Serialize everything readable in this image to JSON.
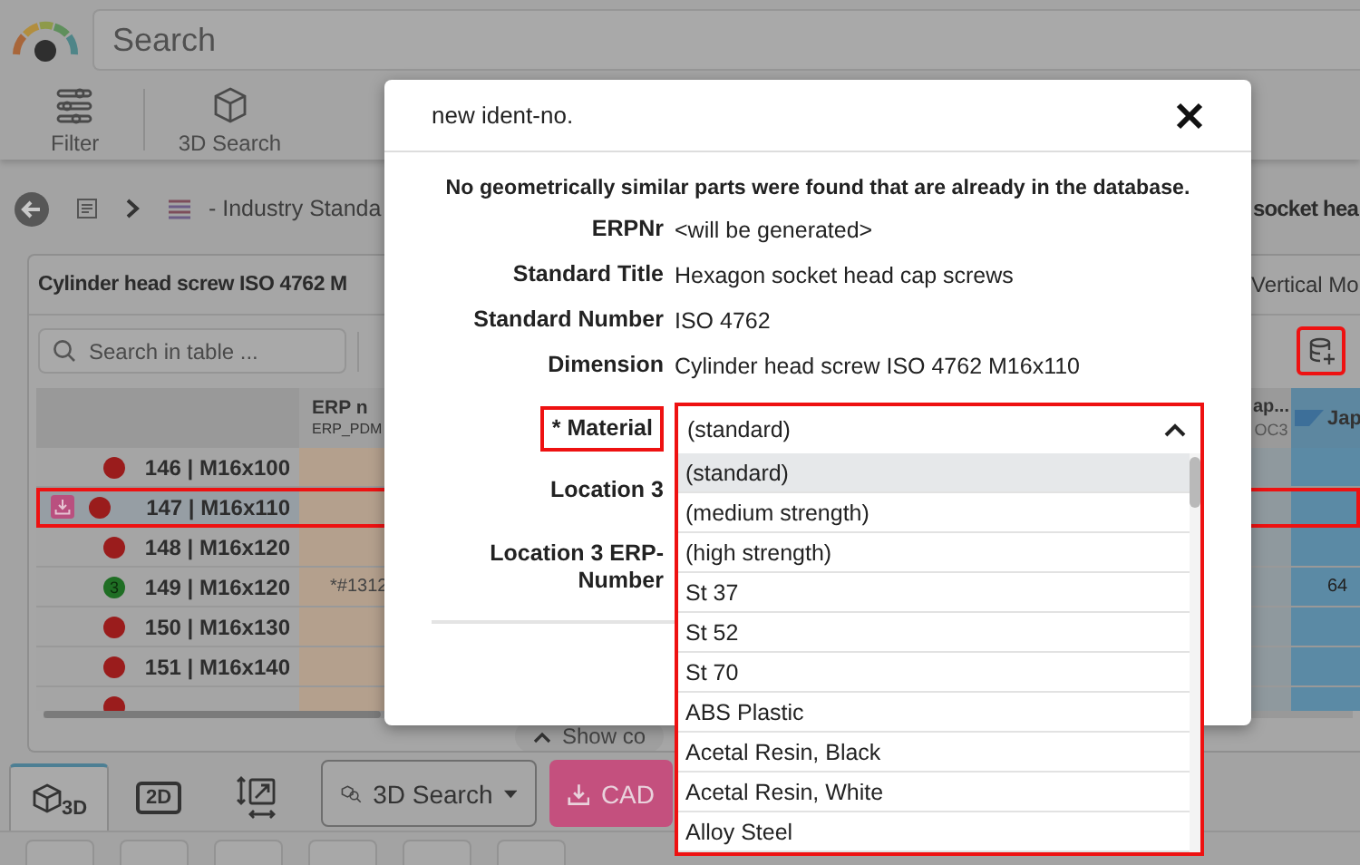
{
  "search": {
    "placeholder": "Search"
  },
  "toolbar": [
    {
      "label": "Filter"
    },
    {
      "label": "3D Search"
    }
  ],
  "breadcrumb": {
    "path_text": "- Industry Standa",
    "title_text": "socket hea"
  },
  "panel": {
    "title": "Cylinder head screw ISO 4762 M",
    "side_tab": "Vertical Mo",
    "table_search": {
      "placeholder": "Search in table ..."
    },
    "add_button_highlighted": true
  },
  "table": {
    "columns": [
      {
        "title": "ERP n",
        "subtitle": "ERP_PDM"
      },
      {
        "title": "ap...",
        "subtitle": "OC3"
      },
      {
        "title": "Jap"
      }
    ],
    "rows": [
      {
        "label": "146 | M16x100",
        "color": "#9a1c1c",
        "selected": false,
        "highlighted": false,
        "downloaded": false
      },
      {
        "label": "147 | M16x110",
        "color": "#9a1c1c",
        "selected": true,
        "highlighted": true,
        "downloaded": true
      },
      {
        "label": "148 | M16x120",
        "color": "#9a1c1c",
        "selected": false,
        "highlighted": false,
        "downloaded": false
      },
      {
        "label": "149 | M16x120",
        "color": "#1f6e24",
        "badge": "3",
        "erp": "*#1312",
        "jap": "64",
        "selected": false,
        "highlighted": false,
        "downloaded": false
      },
      {
        "label": "150 | M16x130",
        "color": "#9a1c1c",
        "selected": false,
        "highlighted": false,
        "downloaded": false
      },
      {
        "label": "151 | M16x140",
        "color": "#9a1c1c",
        "selected": false,
        "highlighted": false,
        "downloaded": false
      },
      {
        "color": "#9a1c1c",
        "selected": false,
        "highlighted": false,
        "downloaded": false
      }
    ],
    "show_more": "Show co"
  },
  "bottom": {
    "view_tabs": [
      {
        "label": "3D",
        "selected": true
      },
      {
        "label": "2D",
        "selected": false
      },
      {
        "selected": false
      }
    ],
    "search_button": "3D Search",
    "cad_button": "CAD"
  },
  "dialog": {
    "title": "new ident-no.",
    "message": "No geometrically similar parts were found that are already in the database.",
    "fields": [
      {
        "kind": "text",
        "label": "ERPNr",
        "value": "<will be generated>"
      },
      {
        "kind": "text",
        "label": "Standard Title",
        "value": "Hexagon socket head cap screws"
      },
      {
        "kind": "text",
        "label": "Standard Number",
        "value": "ISO 4762"
      },
      {
        "kind": "text",
        "label": "Dimension",
        "value": "Cylinder head screw ISO 4762 M16x110"
      },
      {
        "kind": "select",
        "label": "* Material",
        "value": "(standard)",
        "highlighted": true,
        "expanded": true,
        "options": [
          {
            "label": "(standard)",
            "selected": true
          },
          {
            "label": "(medium strength)",
            "selected": false
          },
          {
            "label": "(high strength)",
            "selected": false
          },
          {
            "label": "St 37",
            "selected": false
          },
          {
            "label": "St 52",
            "selected": false
          },
          {
            "label": "St 70",
            "selected": false
          },
          {
            "label": "ABS Plastic",
            "selected": false
          },
          {
            "label": "Acetal Resin, Black",
            "selected": false
          },
          {
            "label": "Acetal Resin, White",
            "selected": false
          },
          {
            "label": "Alloy Steel",
            "selected": false
          }
        ]
      },
      {
        "kind": "blank",
        "label": "Location 3"
      },
      {
        "kind": "blank",
        "label": "Location 3 ERP-Number"
      }
    ]
  }
}
